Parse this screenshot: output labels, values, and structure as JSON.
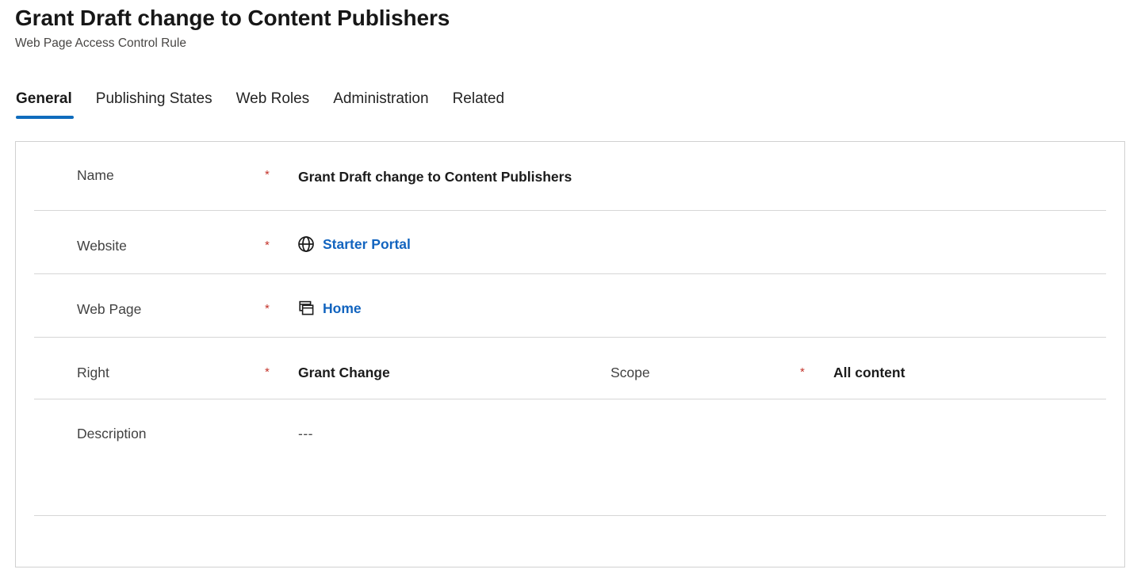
{
  "header": {
    "title": "Grant Draft change to Content Publishers",
    "subtitle": "Web Page Access Control Rule"
  },
  "colors": {
    "accent": "#0f6cbd",
    "link": "#1264bf",
    "required_asterisk": "#c4342b",
    "card_border": "#d1d1d1",
    "divider": "#d6d6d6"
  },
  "tabs": [
    {
      "label": "General",
      "active": true
    },
    {
      "label": "Publishing States",
      "active": false
    },
    {
      "label": "Web Roles",
      "active": false
    },
    {
      "label": "Administration",
      "active": false
    },
    {
      "label": "Related",
      "active": false
    }
  ],
  "form": {
    "required_marker": "*",
    "fields": {
      "name": {
        "label": "Name",
        "required": true,
        "value": "Grant Draft change to Content Publishers"
      },
      "website": {
        "label": "Website",
        "required": true,
        "value": "Starter Portal",
        "icon": "globe-icon",
        "is_link": true
      },
      "web_page": {
        "label": "Web Page",
        "required": true,
        "value": "Home",
        "icon": "cascading-windows-icon",
        "is_link": true
      },
      "right": {
        "label": "Right",
        "required": true,
        "value": "Grant Change"
      },
      "scope": {
        "label": "Scope",
        "required": true,
        "value": "All content"
      },
      "description": {
        "label": "Description",
        "required": false,
        "value": "---"
      }
    }
  }
}
